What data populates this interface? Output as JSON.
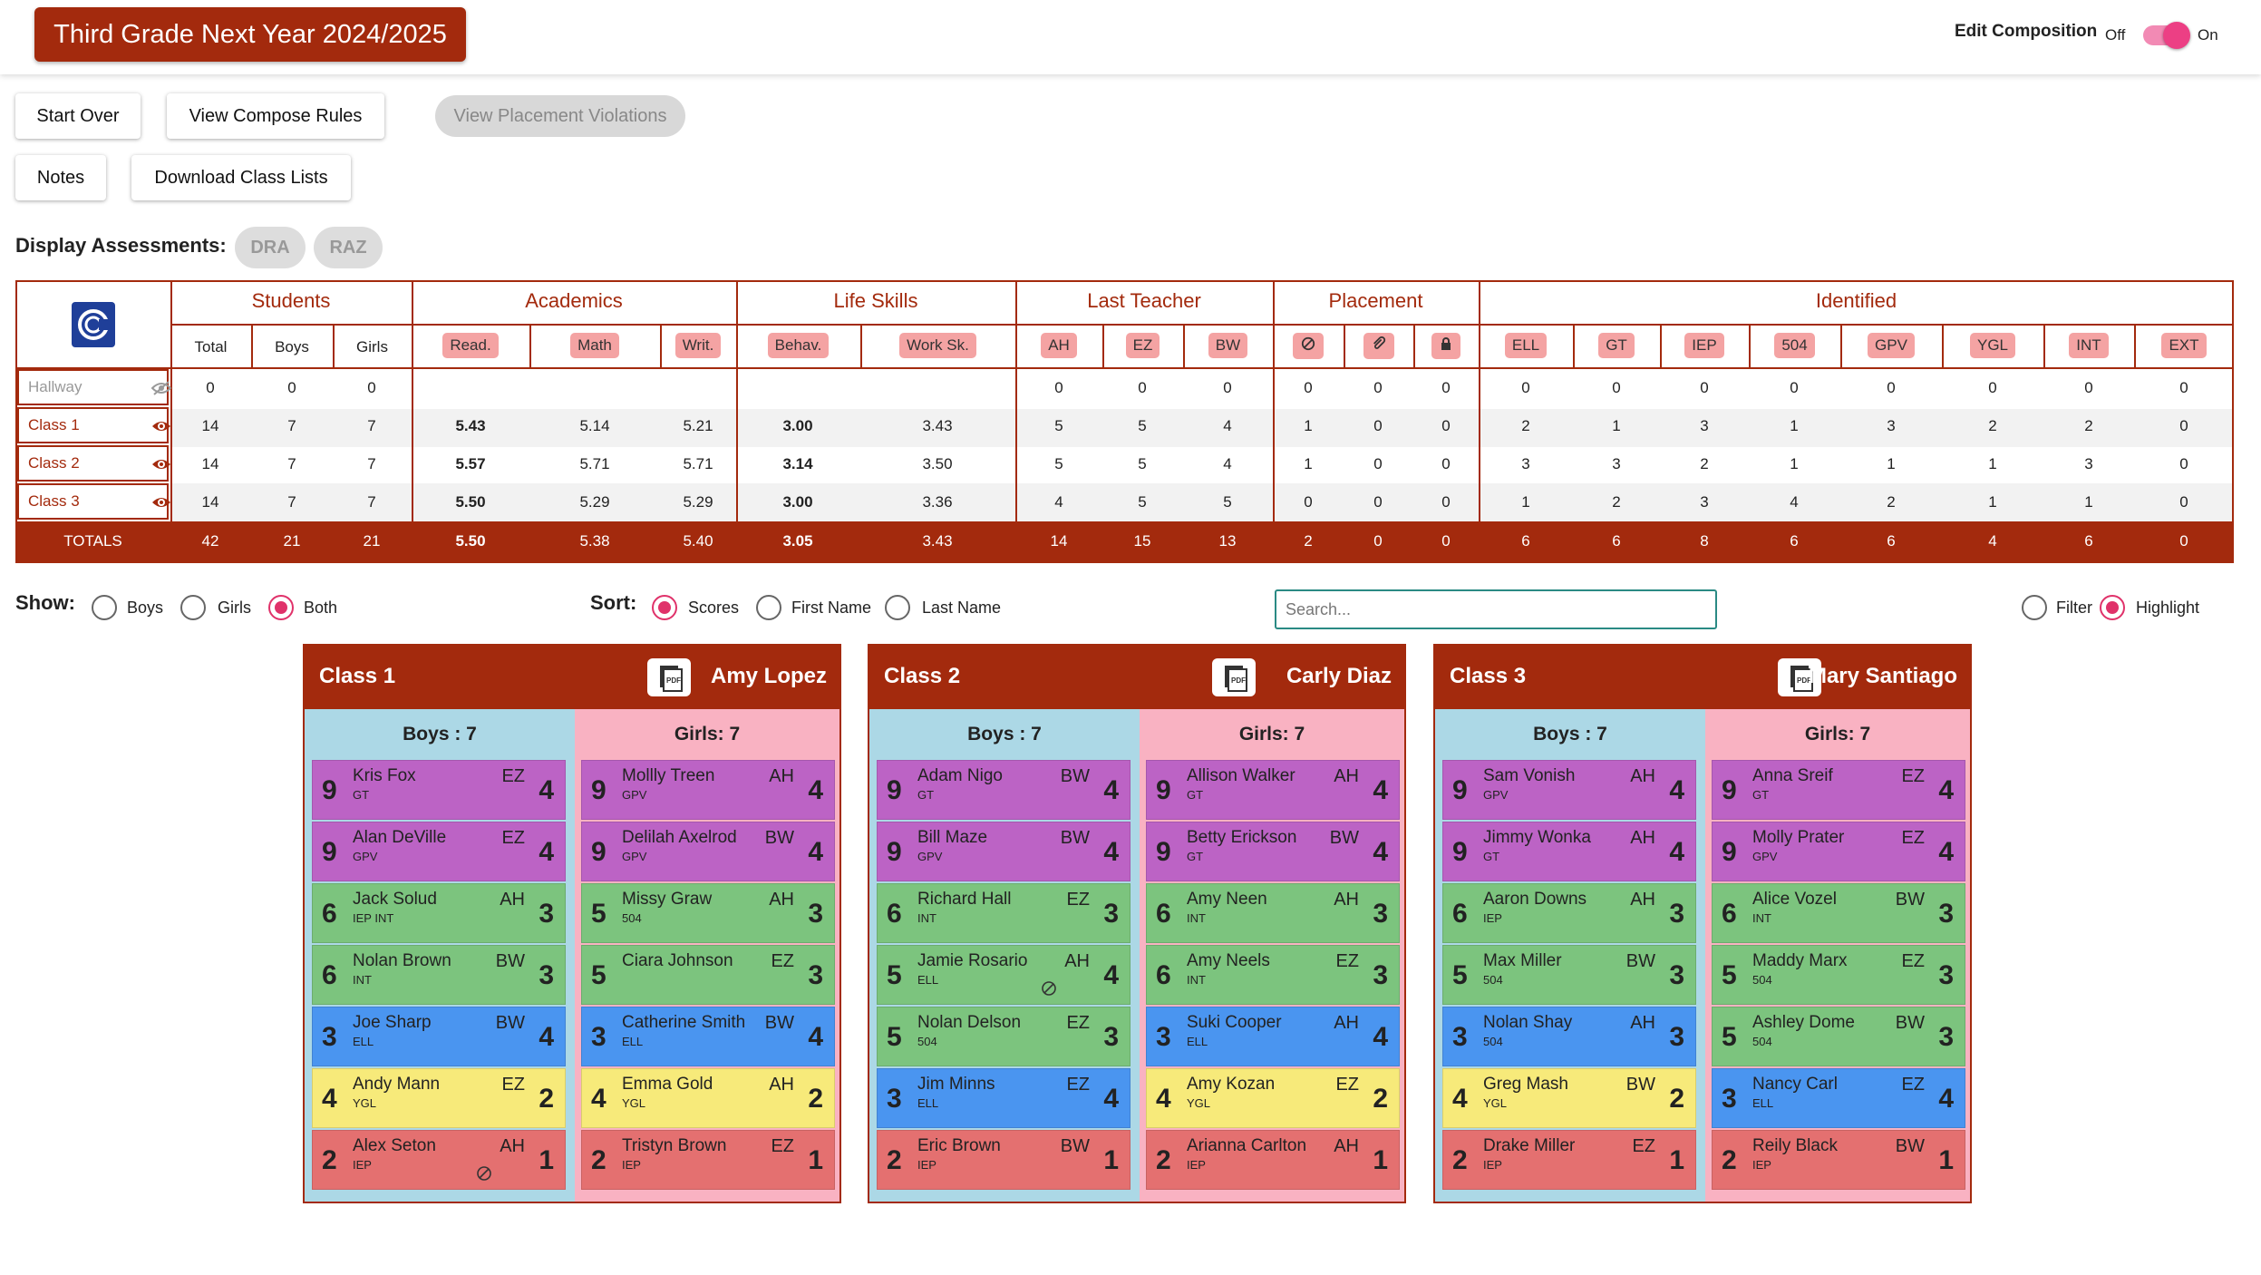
{
  "app": {
    "title": "Third Grade Next Year 2024/2025",
    "edit_composition": "Edit Composition",
    "off": "Off",
    "on": "On"
  },
  "toolbar": {
    "start_over": "Start Over",
    "view_compose_rules": "View Compose Rules",
    "view_violations": "View Placement Violations",
    "notes": "Notes",
    "download": "Download Class Lists"
  },
  "assessments": {
    "label": "Display Assessments:",
    "chips": [
      "DRA",
      "RAZ"
    ]
  },
  "summary": {
    "groups": {
      "students": "Students",
      "academics": "Academics",
      "life_skills": "Life Skills",
      "last_teacher": "Last Teacher",
      "placement": "Placement",
      "identified": "Identified"
    },
    "subheads": {
      "total": "Total",
      "boys": "Boys",
      "girls": "Girls",
      "read": "Read.",
      "math": "Math",
      "writ": "Writ.",
      "behav": "Behav.",
      "work": "Work Sk.",
      "ah": "AH",
      "ez": "EZ",
      "bw": "BW",
      "ell": "ELL",
      "gt": "GT",
      "iep": "IEP",
      "s504": "504",
      "gpv": "GPV",
      "ygl": "YGL",
      "int": "INT",
      "ext": "EXT"
    },
    "rows": [
      {
        "name": "Hallway",
        "vals": [
          "0",
          "0",
          "0",
          "",
          "",
          "",
          "",
          "",
          "0",
          "0",
          "0",
          "0",
          "0",
          "0",
          "0",
          "0",
          "0",
          "0",
          "0",
          "0",
          "0",
          "0"
        ]
      },
      {
        "name": "Class 1",
        "vals": [
          "14",
          "7",
          "7",
          "5.43",
          "5.14",
          "5.21",
          "3.00",
          "3.43",
          "5",
          "5",
          "4",
          "1",
          "0",
          "0",
          "2",
          "1",
          "3",
          "1",
          "3",
          "2",
          "2",
          "0"
        ]
      },
      {
        "name": "Class 2",
        "vals": [
          "14",
          "7",
          "7",
          "5.57",
          "5.71",
          "5.71",
          "3.14",
          "3.50",
          "5",
          "5",
          "4",
          "1",
          "0",
          "0",
          "3",
          "3",
          "2",
          "1",
          "1",
          "1",
          "3",
          "0"
        ]
      },
      {
        "name": "Class 3",
        "vals": [
          "14",
          "7",
          "7",
          "5.50",
          "5.29",
          "5.29",
          "3.00",
          "3.36",
          "4",
          "5",
          "5",
          "0",
          "0",
          "0",
          "1",
          "2",
          "3",
          "4",
          "2",
          "1",
          "1",
          "0"
        ]
      }
    ],
    "totals": {
      "name": "TOTALS",
      "vals": [
        "42",
        "21",
        "21",
        "5.50",
        "5.38",
        "5.40",
        "3.05",
        "3.43",
        "14",
        "15",
        "13",
        "2",
        "0",
        "0",
        "6",
        "6",
        "8",
        "6",
        "6",
        "4",
        "6",
        "0"
      ]
    }
  },
  "filters": {
    "show_label": "Show:",
    "boys": "Boys",
    "girls": "Girls",
    "both": "Both",
    "sort_label": "Sort:",
    "scores": "Scores",
    "first_name": "First Name",
    "last_name": "Last Name",
    "search_placeholder": "Search...",
    "filter": "Filter",
    "highlight": "Highlight"
  },
  "classes": [
    {
      "name": "Class 1",
      "teacher": "Amy Lopez",
      "boys_label": "Boys : 7",
      "girls_label": "Girls: 7",
      "boys": [
        {
          "score": "9",
          "name": "Kris Fox",
          "tags": "GT",
          "teacher": "EZ",
          "rating": "4",
          "color": "purple"
        },
        {
          "score": "9",
          "name": "Alan DeVille",
          "tags": "GPV",
          "teacher": "EZ",
          "rating": "4",
          "color": "purple"
        },
        {
          "score": "6",
          "name": "Jack Solud",
          "tags": "IEP INT",
          "teacher": "AH",
          "rating": "3",
          "color": "green"
        },
        {
          "score": "6",
          "name": "Nolan Brown",
          "tags": "INT",
          "teacher": "BW",
          "rating": "3",
          "color": "green"
        },
        {
          "score": "3",
          "name": "Joe Sharp",
          "tags": "ELL",
          "teacher": "BW",
          "rating": "4",
          "color": "blue"
        },
        {
          "score": "4",
          "name": "Andy Mann",
          "tags": "YGL",
          "teacher": "EZ",
          "rating": "2",
          "color": "yellow"
        },
        {
          "score": "2",
          "name": "Alex Seton",
          "tags": "IEP",
          "teacher": "AH",
          "rating": "1",
          "color": "red",
          "blocked": true
        }
      ],
      "girls": [
        {
          "score": "9",
          "name": "Mollly Treen",
          "tags": "GPV",
          "teacher": "AH",
          "rating": "4",
          "color": "purple"
        },
        {
          "score": "9",
          "name": "Delilah Axelrod",
          "tags": "GPV",
          "teacher": "BW",
          "rating": "4",
          "color": "purple"
        },
        {
          "score": "5",
          "name": "Missy Graw",
          "tags": "504",
          "teacher": "AH",
          "rating": "3",
          "color": "green"
        },
        {
          "score": "5",
          "name": "Ciara Johnson",
          "tags": "",
          "teacher": "EZ",
          "rating": "3",
          "color": "green"
        },
        {
          "score": "3",
          "name": "Catherine Smith",
          "tags": "ELL",
          "teacher": "BW",
          "rating": "4",
          "color": "blue"
        },
        {
          "score": "4",
          "name": "Emma Gold",
          "tags": "YGL",
          "teacher": "AH",
          "rating": "2",
          "color": "yellow"
        },
        {
          "score": "2",
          "name": "Tristyn Brown",
          "tags": "IEP",
          "teacher": "EZ",
          "rating": "1",
          "color": "red"
        }
      ]
    },
    {
      "name": "Class 2",
      "teacher": "Carly Diaz",
      "boys_label": "Boys : 7",
      "girls_label": "Girls: 7",
      "boys": [
        {
          "score": "9",
          "name": "Adam Nigo",
          "tags": "GT",
          "teacher": "BW",
          "rating": "4",
          "color": "purple"
        },
        {
          "score": "9",
          "name": "Bill Maze",
          "tags": "GPV",
          "teacher": "BW",
          "rating": "4",
          "color": "purple"
        },
        {
          "score": "6",
          "name": "Richard Hall",
          "tags": "INT",
          "teacher": "EZ",
          "rating": "3",
          "color": "green"
        },
        {
          "score": "5",
          "name": "Jamie Rosario",
          "tags": "ELL",
          "teacher": "AH",
          "rating": "4",
          "color": "green",
          "blocked": true
        },
        {
          "score": "5",
          "name": "Nolan Delson",
          "tags": "504",
          "teacher": "EZ",
          "rating": "3",
          "color": "green"
        },
        {
          "score": "3",
          "name": "Jim Minns",
          "tags": "ELL",
          "teacher": "EZ",
          "rating": "4",
          "color": "blue"
        },
        {
          "score": "2",
          "name": "Eric Brown",
          "tags": "IEP",
          "teacher": "BW",
          "rating": "1",
          "color": "red"
        }
      ],
      "girls": [
        {
          "score": "9",
          "name": "Allison Walker",
          "tags": "GT",
          "teacher": "AH",
          "rating": "4",
          "color": "purple"
        },
        {
          "score": "9",
          "name": "Betty Erickson",
          "tags": "GT",
          "teacher": "BW",
          "rating": "4",
          "color": "purple"
        },
        {
          "score": "6",
          "name": "Amy Neen",
          "tags": "INT",
          "teacher": "AH",
          "rating": "3",
          "color": "green"
        },
        {
          "score": "6",
          "name": "Amy Neels",
          "tags": "INT",
          "teacher": "EZ",
          "rating": "3",
          "color": "green"
        },
        {
          "score": "3",
          "name": "Suki Cooper",
          "tags": "ELL",
          "teacher": "AH",
          "rating": "4",
          "color": "blue"
        },
        {
          "score": "4",
          "name": "Amy Kozan",
          "tags": "YGL",
          "teacher": "EZ",
          "rating": "2",
          "color": "yellow"
        },
        {
          "score": "2",
          "name": "Arianna Carlton",
          "tags": "IEP",
          "teacher": "AH",
          "rating": "1",
          "color": "red"
        }
      ]
    },
    {
      "name": "Class 3",
      "teacher": "Mary Santiago",
      "boys_label": "Boys : 7",
      "girls_label": "Girls: 7",
      "boys": [
        {
          "score": "9",
          "name": "Sam Vonish",
          "tags": "GPV",
          "teacher": "AH",
          "rating": "4",
          "color": "purple"
        },
        {
          "score": "9",
          "name": "Jimmy Wonka",
          "tags": "GT",
          "teacher": "AH",
          "rating": "4",
          "color": "purple"
        },
        {
          "score": "6",
          "name": "Aaron Downs",
          "tags": "IEP",
          "teacher": "AH",
          "rating": "3",
          "color": "green"
        },
        {
          "score": "5",
          "name": "Max Miller",
          "tags": "504",
          "teacher": "BW",
          "rating": "3",
          "color": "green"
        },
        {
          "score": "3",
          "name": "Nolan Shay",
          "tags": "504",
          "teacher": "AH",
          "rating": "3",
          "color": "blue"
        },
        {
          "score": "4",
          "name": "Greg Mash",
          "tags": "YGL",
          "teacher": "BW",
          "rating": "2",
          "color": "yellow"
        },
        {
          "score": "2",
          "name": "Drake Miller",
          "tags": "IEP",
          "teacher": "EZ",
          "rating": "1",
          "color": "red"
        }
      ],
      "girls": [
        {
          "score": "9",
          "name": "Anna Sreif",
          "tags": "GT",
          "teacher": "EZ",
          "rating": "4",
          "color": "purple"
        },
        {
          "score": "9",
          "name": "Molly Prater",
          "tags": "GPV",
          "teacher": "EZ",
          "rating": "4",
          "color": "purple"
        },
        {
          "score": "6",
          "name": "Alice Vozel",
          "tags": "INT",
          "teacher": "BW",
          "rating": "3",
          "color": "green"
        },
        {
          "score": "5",
          "name": "Maddy Marx",
          "tags": "504",
          "teacher": "EZ",
          "rating": "3",
          "color": "green"
        },
        {
          "score": "5",
          "name": "Ashley Dome",
          "tags": "504",
          "teacher": "BW",
          "rating": "3",
          "color": "green"
        },
        {
          "score": "3",
          "name": "Nancy Carl",
          "tags": "ELL",
          "teacher": "EZ",
          "rating": "4",
          "color": "blue"
        },
        {
          "score": "2",
          "name": "Reily Black",
          "tags": "IEP",
          "teacher": "BW",
          "rating": "1",
          "color": "red"
        }
      ]
    }
  ]
}
